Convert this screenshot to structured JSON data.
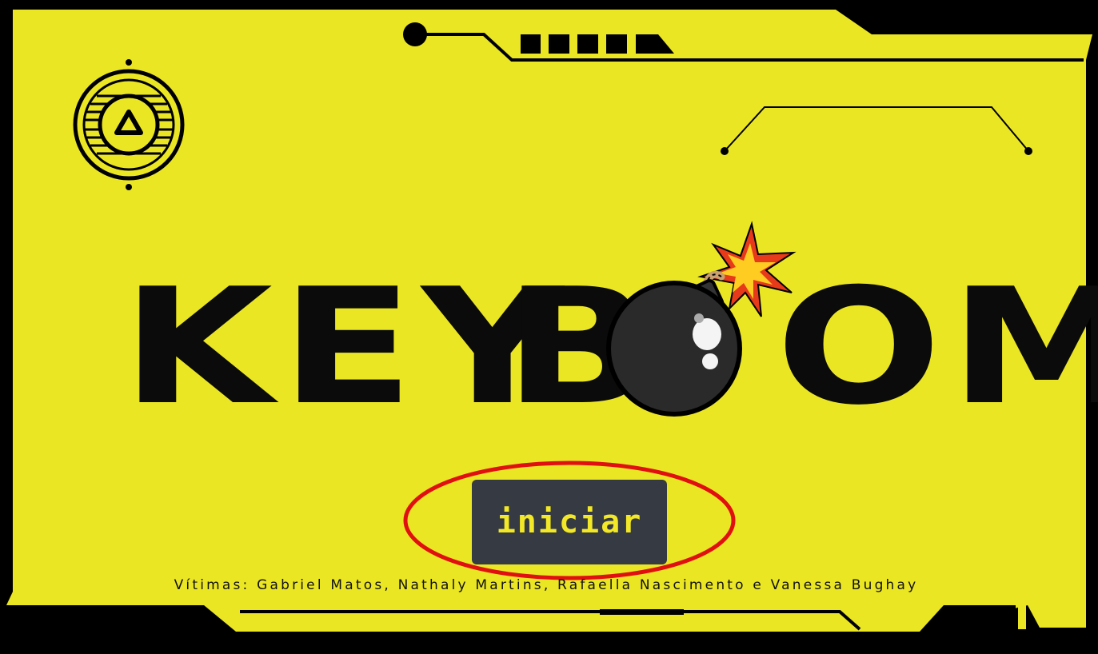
{
  "game": {
    "title_part1": "KEY",
    "title_part2_start": "B",
    "title_part2_end": "OM",
    "start_button_label": "iniciar",
    "credits": "Vítimas: Gabriel Matos, Nathaly Martins, Rafaella Nascimento e Vanessa Bughay"
  },
  "icons": {
    "logo": "triangle-emblem-icon",
    "bomb": "bomb-icon",
    "spark": "spark-icon"
  },
  "colors": {
    "panel_yellow": "#ebe624",
    "frame_black": "#000000",
    "button_bg": "#363a43",
    "button_text": "#f2e827",
    "highlight_red": "#e01010"
  }
}
